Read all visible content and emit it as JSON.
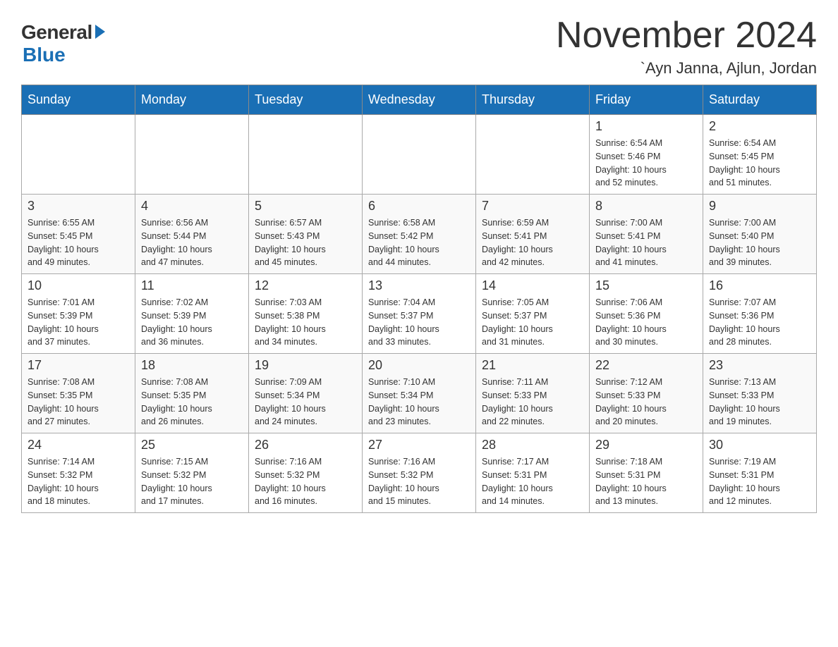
{
  "header": {
    "logo_general": "General",
    "logo_blue": "Blue",
    "title": "November 2024",
    "subtitle": "`Ayn Janna, Ajlun, Jordan"
  },
  "weekdays": [
    "Sunday",
    "Monday",
    "Tuesday",
    "Wednesday",
    "Thursday",
    "Friday",
    "Saturday"
  ],
  "weeks": [
    [
      {
        "day": "",
        "info": ""
      },
      {
        "day": "",
        "info": ""
      },
      {
        "day": "",
        "info": ""
      },
      {
        "day": "",
        "info": ""
      },
      {
        "day": "",
        "info": ""
      },
      {
        "day": "1",
        "info": "Sunrise: 6:54 AM\nSunset: 5:46 PM\nDaylight: 10 hours\nand 52 minutes."
      },
      {
        "day": "2",
        "info": "Sunrise: 6:54 AM\nSunset: 5:45 PM\nDaylight: 10 hours\nand 51 minutes."
      }
    ],
    [
      {
        "day": "3",
        "info": "Sunrise: 6:55 AM\nSunset: 5:45 PM\nDaylight: 10 hours\nand 49 minutes."
      },
      {
        "day": "4",
        "info": "Sunrise: 6:56 AM\nSunset: 5:44 PM\nDaylight: 10 hours\nand 47 minutes."
      },
      {
        "day": "5",
        "info": "Sunrise: 6:57 AM\nSunset: 5:43 PM\nDaylight: 10 hours\nand 45 minutes."
      },
      {
        "day": "6",
        "info": "Sunrise: 6:58 AM\nSunset: 5:42 PM\nDaylight: 10 hours\nand 44 minutes."
      },
      {
        "day": "7",
        "info": "Sunrise: 6:59 AM\nSunset: 5:41 PM\nDaylight: 10 hours\nand 42 minutes."
      },
      {
        "day": "8",
        "info": "Sunrise: 7:00 AM\nSunset: 5:41 PM\nDaylight: 10 hours\nand 41 minutes."
      },
      {
        "day": "9",
        "info": "Sunrise: 7:00 AM\nSunset: 5:40 PM\nDaylight: 10 hours\nand 39 minutes."
      }
    ],
    [
      {
        "day": "10",
        "info": "Sunrise: 7:01 AM\nSunset: 5:39 PM\nDaylight: 10 hours\nand 37 minutes."
      },
      {
        "day": "11",
        "info": "Sunrise: 7:02 AM\nSunset: 5:39 PM\nDaylight: 10 hours\nand 36 minutes."
      },
      {
        "day": "12",
        "info": "Sunrise: 7:03 AM\nSunset: 5:38 PM\nDaylight: 10 hours\nand 34 minutes."
      },
      {
        "day": "13",
        "info": "Sunrise: 7:04 AM\nSunset: 5:37 PM\nDaylight: 10 hours\nand 33 minutes."
      },
      {
        "day": "14",
        "info": "Sunrise: 7:05 AM\nSunset: 5:37 PM\nDaylight: 10 hours\nand 31 minutes."
      },
      {
        "day": "15",
        "info": "Sunrise: 7:06 AM\nSunset: 5:36 PM\nDaylight: 10 hours\nand 30 minutes."
      },
      {
        "day": "16",
        "info": "Sunrise: 7:07 AM\nSunset: 5:36 PM\nDaylight: 10 hours\nand 28 minutes."
      }
    ],
    [
      {
        "day": "17",
        "info": "Sunrise: 7:08 AM\nSunset: 5:35 PM\nDaylight: 10 hours\nand 27 minutes."
      },
      {
        "day": "18",
        "info": "Sunrise: 7:08 AM\nSunset: 5:35 PM\nDaylight: 10 hours\nand 26 minutes."
      },
      {
        "day": "19",
        "info": "Sunrise: 7:09 AM\nSunset: 5:34 PM\nDaylight: 10 hours\nand 24 minutes."
      },
      {
        "day": "20",
        "info": "Sunrise: 7:10 AM\nSunset: 5:34 PM\nDaylight: 10 hours\nand 23 minutes."
      },
      {
        "day": "21",
        "info": "Sunrise: 7:11 AM\nSunset: 5:33 PM\nDaylight: 10 hours\nand 22 minutes."
      },
      {
        "day": "22",
        "info": "Sunrise: 7:12 AM\nSunset: 5:33 PM\nDaylight: 10 hours\nand 20 minutes."
      },
      {
        "day": "23",
        "info": "Sunrise: 7:13 AM\nSunset: 5:33 PM\nDaylight: 10 hours\nand 19 minutes."
      }
    ],
    [
      {
        "day": "24",
        "info": "Sunrise: 7:14 AM\nSunset: 5:32 PM\nDaylight: 10 hours\nand 18 minutes."
      },
      {
        "day": "25",
        "info": "Sunrise: 7:15 AM\nSunset: 5:32 PM\nDaylight: 10 hours\nand 17 minutes."
      },
      {
        "day": "26",
        "info": "Sunrise: 7:16 AM\nSunset: 5:32 PM\nDaylight: 10 hours\nand 16 minutes."
      },
      {
        "day": "27",
        "info": "Sunrise: 7:16 AM\nSunset: 5:32 PM\nDaylight: 10 hours\nand 15 minutes."
      },
      {
        "day": "28",
        "info": "Sunrise: 7:17 AM\nSunset: 5:31 PM\nDaylight: 10 hours\nand 14 minutes."
      },
      {
        "day": "29",
        "info": "Sunrise: 7:18 AM\nSunset: 5:31 PM\nDaylight: 10 hours\nand 13 minutes."
      },
      {
        "day": "30",
        "info": "Sunrise: 7:19 AM\nSunset: 5:31 PM\nDaylight: 10 hours\nand 12 minutes."
      }
    ]
  ]
}
